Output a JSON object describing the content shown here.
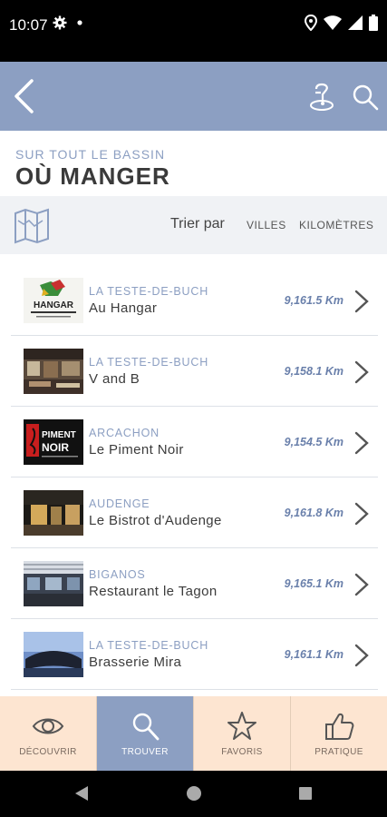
{
  "status_bar": {
    "time": "10:07",
    "icons": [
      "gear-icon",
      "dot-icon",
      "location-icon",
      "wifi-icon",
      "signal-icon",
      "battery-icon"
    ]
  },
  "header": {
    "back_icon": "back-arrow-icon",
    "map_icon": "map-pin-icon",
    "search_icon": "search-icon",
    "color": "#8c9fc2"
  },
  "page": {
    "subtitle": "SUR TOUT LE BASSIN",
    "title": "OÙ MANGER"
  },
  "sort": {
    "label": "Trier par",
    "options": [
      "VILLES",
      "KILOMÈTRES"
    ]
  },
  "restaurants": [
    {
      "city": "LA TESTE-DE-BUCH",
      "name": "Au Hangar",
      "distance": "9,161.5 Km"
    },
    {
      "city": "LA TESTE-DE-BUCH",
      "name": "V and B",
      "distance": "9,158.1 Km"
    },
    {
      "city": "ARCACHON",
      "name": "Le Piment Noir",
      "distance": "9,154.5 Km"
    },
    {
      "city": "AUDENGE",
      "name": "Le Bistrot d'Audenge",
      "distance": "9,161.8 Km"
    },
    {
      "city": "BIGANOS",
      "name": "Restaurant le Tagon",
      "distance": "9,165.1 Km"
    },
    {
      "city": "LA TESTE-DE-BUCH",
      "name": "Brasserie Mira",
      "distance": "9,161.1 Km"
    }
  ],
  "thumbnails": {
    "hangar_text": "HANGAR",
    "piment_line1": "PIMENT",
    "piment_line2": "NOIR"
  },
  "tabs": [
    {
      "label": "DÉCOUVRIR",
      "icon": "eye-icon",
      "active": false
    },
    {
      "label": "TROUVER",
      "icon": "search-icon",
      "active": true
    },
    {
      "label": "FAVORIS",
      "icon": "star-icon",
      "active": false
    },
    {
      "label": "PRATIQUE",
      "icon": "thumbs-up-icon",
      "active": false
    }
  ],
  "colors": {
    "accent": "#8c9fc2",
    "tab_background": "#fde5d1",
    "distance": "#6a80ab"
  }
}
